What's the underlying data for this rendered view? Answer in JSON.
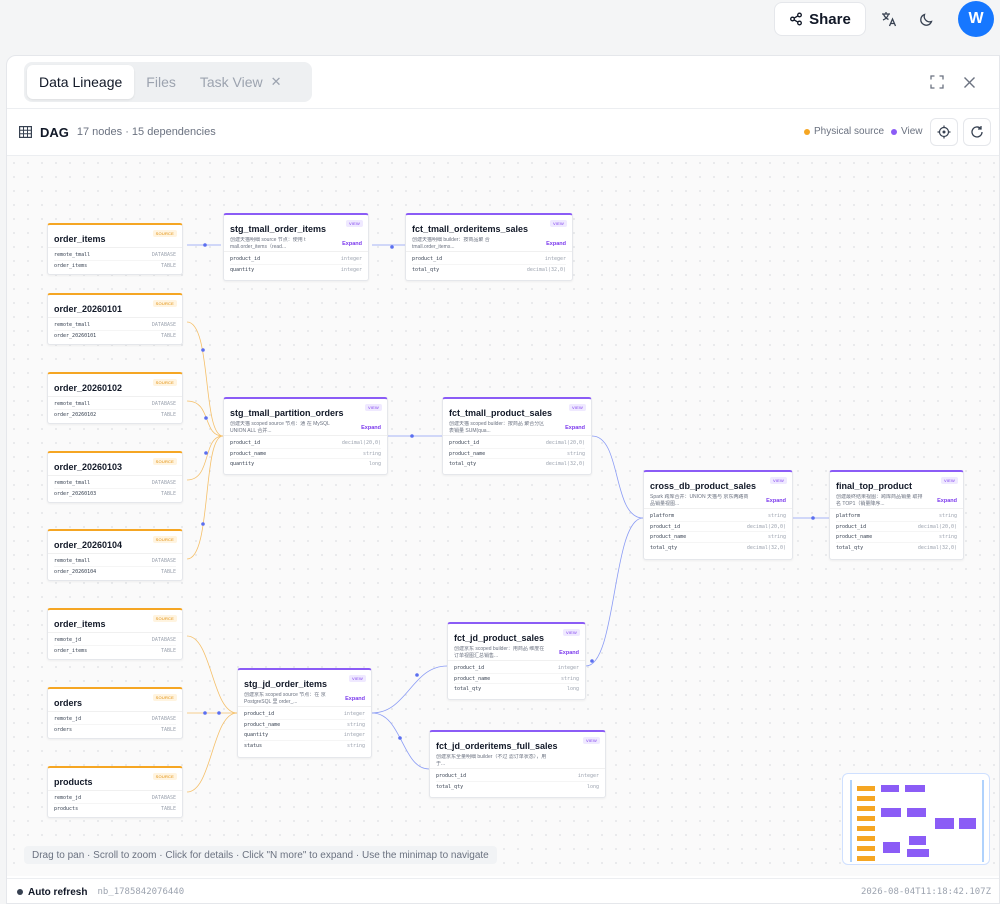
{
  "topbar": {
    "share_label": "Share",
    "avatar_initial": "W"
  },
  "tabs": [
    {
      "label": "Data Lineage",
      "active": true
    },
    {
      "label": "Files",
      "active": false
    },
    {
      "label": "Task View",
      "active": false
    }
  ],
  "dag": {
    "title": "DAG",
    "meta": "17 nodes · 15 dependencies"
  },
  "legend": {
    "physical_source": "Physical source",
    "view": "View",
    "physical_color": "#f5a623",
    "view_color": "#8b5cf6"
  },
  "nodes": {
    "src_order_items_1": {
      "name": "order_items",
      "badge": "SOURCE",
      "rows": [
        [
          "remote_tmall",
          "DATABASE"
        ],
        [
          "order_items",
          "TABLE"
        ]
      ]
    },
    "src_order_20260101": {
      "name": "order_20260101",
      "badge": "SOURCE",
      "rows": [
        [
          "remote_tmall",
          "DATABASE"
        ],
        [
          "order_20260101",
          "TABLE"
        ]
      ]
    },
    "src_order_20260102": {
      "name": "order_20260102",
      "badge": "SOURCE",
      "rows": [
        [
          "remote_tmall",
          "DATABASE"
        ],
        [
          "order_20260102",
          "TABLE"
        ]
      ]
    },
    "src_order_20260103": {
      "name": "order_20260103",
      "badge": "SOURCE",
      "rows": [
        [
          "remote_tmall",
          "DATABASE"
        ],
        [
          "order_20260103",
          "TABLE"
        ]
      ]
    },
    "src_order_20260104": {
      "name": "order_20260104",
      "badge": "SOURCE",
      "rows": [
        [
          "remote_tmall",
          "DATABASE"
        ],
        [
          "order_20260104",
          "TABLE"
        ]
      ]
    },
    "src_order_items_2": {
      "name": "order_items",
      "badge": "SOURCE",
      "rows": [
        [
          "remote_jd",
          "DATABASE"
        ],
        [
          "order_items",
          "TABLE"
        ]
      ]
    },
    "src_orders": {
      "name": "orders",
      "badge": "SOURCE",
      "rows": [
        [
          "remote_jd",
          "DATABASE"
        ],
        [
          "orders",
          "TABLE"
        ]
      ]
    },
    "src_products": {
      "name": "products",
      "badge": "SOURCE",
      "rows": [
        [
          "remote_jd",
          "DATABASE"
        ],
        [
          "products",
          "TABLE"
        ]
      ]
    },
    "stg_tmall_order_items": {
      "name": "stg_tmall_order_items",
      "badge": "VIEW",
      "desc": "创建天猫明细 source 节点：使用 t mall.order_items（read...",
      "expand": "Expand",
      "rows": [
        [
          "product_id",
          "integer"
        ],
        [
          "quantity",
          "integer"
        ]
      ]
    },
    "fct_tmall_orderitems_sales": {
      "name": "fct_tmall_orderitems_sales",
      "badge": "VIEW",
      "desc": "创建天猫明细 builder：按商品聚 合 tmall.order_items...",
      "expand": "Expand",
      "rows": [
        [
          "product_id",
          "integer"
        ],
        [
          "total_qty",
          "decimal(32,0)"
        ]
      ]
    },
    "stg_tmall_partition_orders": {
      "name": "stg_tmall_partition_orders",
      "badge": "VIEW",
      "desc": "创建天猫 scoped source 节点：通 在 MySQL UNION ALL 合并...",
      "expand": "Expand",
      "rows": [
        [
          "product_id",
          "decimal(20,0)"
        ],
        [
          "product_name",
          "string"
        ],
        [
          "quantity",
          "long"
        ]
      ]
    },
    "fct_tmall_product_sales": {
      "name": "fct_tmall_product_sales",
      "badge": "VIEW",
      "desc": "创建天猫 scoped builder：按商品 聚合分区表销量 SUM(qua...",
      "expand": "Expand",
      "rows": [
        [
          "product_id",
          "decimal(20,0)"
        ],
        [
          "product_name",
          "string"
        ],
        [
          "total_qty",
          "decimal(32,0)"
        ]
      ]
    },
    "cross_db_product_sales": {
      "name": "cross_db_product_sales",
      "badge": "VIEW",
      "desc": "Spark 跨库合并：UNION 天猫与 京东两路商品销量视图...",
      "expand": "Expand",
      "rows": [
        [
          "platform",
          "string"
        ],
        [
          "product_id",
          "decimal(20,0)"
        ],
        [
          "product_name",
          "string"
        ],
        [
          "total_qty",
          "decimal(32,0)"
        ]
      ]
    },
    "final_top_product": {
      "name": "final_top_product",
      "badge": "VIEW",
      "desc": "创建最终结果视图：跨库商品销量 取排名 TOP1（销量降序...",
      "expand": "Expand",
      "rows": [
        [
          "platform",
          "string"
        ],
        [
          "product_id",
          "decimal(20,0)"
        ],
        [
          "product_name",
          "string"
        ],
        [
          "total_qty",
          "decimal(32,0)"
        ]
      ]
    },
    "fct_jd_product_sales": {
      "name": "fct_jd_product_sales",
      "badge": "VIEW",
      "desc": "创建京东 scoped builder：用商品 维度在订单视图汇总销售...",
      "expand": "Expand",
      "rows": [
        [
          "product_id",
          "integer"
        ],
        [
          "product_name",
          "string"
        ],
        [
          "total_qty",
          "long"
        ]
      ]
    },
    "stg_jd_order_items": {
      "name": "stg_jd_order_items",
      "badge": "VIEW",
      "desc": "创建京东 scoped source 节点：在 京 PostgreSQL 里 order_...",
      "expand": "Expand",
      "rows": [
        [
          "product_id",
          "integer"
        ],
        [
          "product_name",
          "string"
        ],
        [
          "quantity",
          "integer"
        ],
        [
          "status",
          "string"
        ]
      ]
    },
    "fct_jd_orderitems_full_sales": {
      "name": "fct_jd_orderitems_full_sales",
      "badge": "VIEW",
      "desc": "创建京东全量明细 builder（不过 滤订单状态），用于...",
      "expand": "",
      "rows": [
        [
          "product_id",
          "integer"
        ],
        [
          "total_qty",
          "long"
        ]
      ]
    }
  },
  "hint": "Drag to pan · Scroll to zoom · Click for details · Click \"N more\" to expand · Use the minimap to navigate",
  "footer": {
    "auto_refresh": "Auto refresh",
    "notebook_id": "nb_1785842076440",
    "timestamp": "2026-08-04T11:18:42.107Z"
  }
}
